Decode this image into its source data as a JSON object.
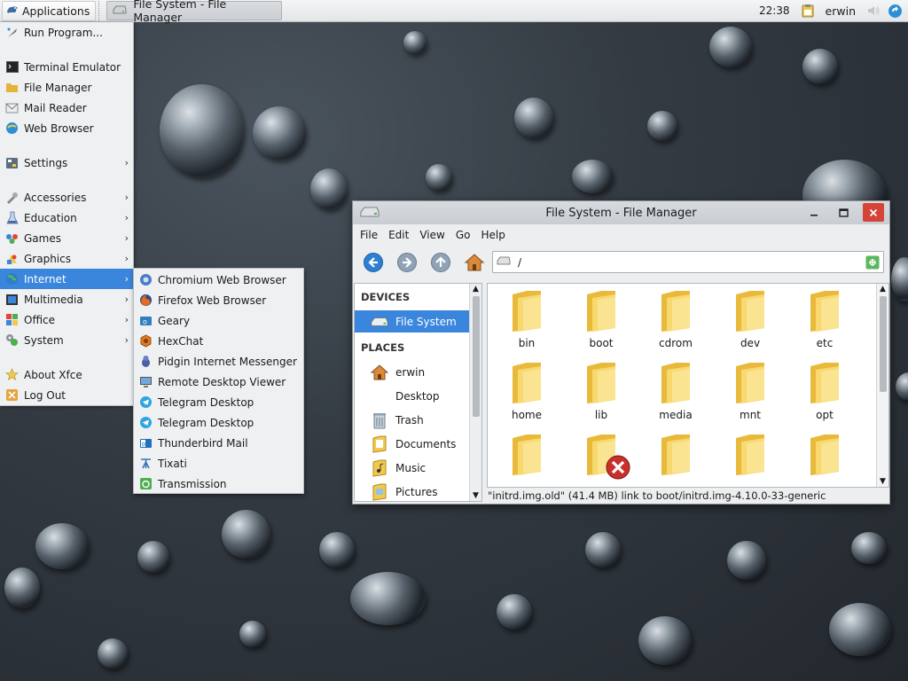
{
  "panel": {
    "apps_label": "Applications",
    "task_label": "File System - File Manager",
    "clock": "22:38",
    "user": "erwin"
  },
  "app_menu": {
    "items": [
      {
        "label": "Run Program...",
        "icon": "run-icon"
      },
      {
        "label": "Terminal Emulator",
        "icon": "terminal-icon"
      },
      {
        "label": "File Manager",
        "icon": "file-manager-icon"
      },
      {
        "label": "Mail Reader",
        "icon": "mail-icon"
      },
      {
        "label": "Web Browser",
        "icon": "web-browser-icon"
      },
      {
        "label": "Settings",
        "icon": "settings-icon"
      },
      {
        "label": "Accessories",
        "icon": "accessories-icon"
      },
      {
        "label": "Education",
        "icon": "education-icon"
      },
      {
        "label": "Games",
        "icon": "games-icon"
      },
      {
        "label": "Graphics",
        "icon": "graphics-icon"
      },
      {
        "label": "Internet",
        "icon": "internet-icon"
      },
      {
        "label": "Multimedia",
        "icon": "multimedia-icon"
      },
      {
        "label": "Office",
        "icon": "office-icon"
      },
      {
        "label": "System",
        "icon": "system-icon"
      },
      {
        "label": "About Xfce",
        "icon": "about-icon"
      },
      {
        "label": "Log Out",
        "icon": "logout-icon"
      }
    ]
  },
  "internet_menu": {
    "items": [
      {
        "label": "Chromium Web Browser",
        "icon": "chromium-icon"
      },
      {
        "label": "Firefox Web Browser",
        "icon": "firefox-icon"
      },
      {
        "label": "Geary",
        "icon": "geary-icon"
      },
      {
        "label": "HexChat",
        "icon": "hexchat-icon"
      },
      {
        "label": "Pidgin Internet Messenger",
        "icon": "pidgin-icon"
      },
      {
        "label": "Remote Desktop Viewer",
        "icon": "remote-desktop-icon"
      },
      {
        "label": "Telegram Desktop",
        "icon": "telegram-icon"
      },
      {
        "label": "Telegram Desktop",
        "icon": "telegram-icon"
      },
      {
        "label": "Thunderbird Mail",
        "icon": "thunderbird-icon"
      },
      {
        "label": "Tixati",
        "icon": "tixati-icon"
      },
      {
        "label": "Transmission",
        "icon": "transmission-icon"
      }
    ]
  },
  "file_manager": {
    "title": "File System - File Manager",
    "menubar": [
      "File",
      "Edit",
      "View",
      "Go",
      "Help"
    ],
    "location": "/",
    "sidebar": {
      "devices_heading": "DEVICES",
      "places_heading": "PLACES",
      "devices": [
        {
          "label": "File System",
          "icon": "drive-icon"
        }
      ],
      "places": [
        {
          "label": "erwin",
          "icon": "home-icon"
        },
        {
          "label": "Desktop",
          "icon": "desktop-icon"
        },
        {
          "label": "Trash",
          "icon": "trash-icon"
        },
        {
          "label": "Documents",
          "icon": "documents-icon"
        },
        {
          "label": "Music",
          "icon": "music-icon"
        },
        {
          "label": "Pictures",
          "icon": "pictures-icon"
        }
      ]
    },
    "folders": [
      "bin",
      "boot",
      "cdrom",
      "dev",
      "etc",
      "home",
      "lib",
      "media",
      "mnt",
      "opt",
      "",
      "",
      "",
      "",
      ""
    ],
    "status": "\"initrd.img.old\" (41.4 MB) link to boot/initrd.img-4.10.0-33-generic",
    "colors": {
      "accent": "#3b86dd",
      "folder": "#f2c94c",
      "close": "#d64337"
    }
  }
}
